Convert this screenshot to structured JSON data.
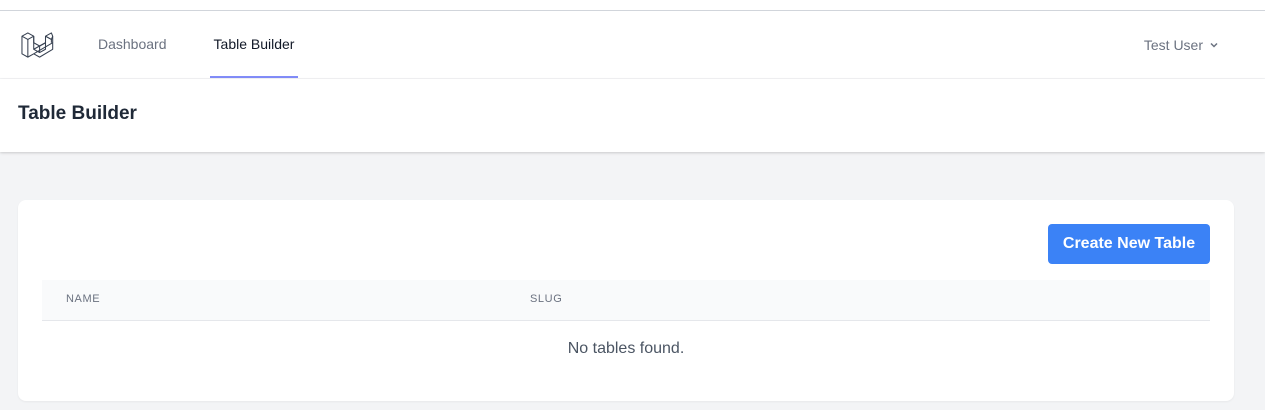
{
  "nav": {
    "links": [
      {
        "label": "Dashboard",
        "active": false
      },
      {
        "label": "Table Builder",
        "active": true
      }
    ],
    "user": {
      "name": "Test User"
    }
  },
  "header": {
    "title": "Table Builder"
  },
  "card": {
    "create_button": "Create New Table",
    "table": {
      "columns": [
        "NAME",
        "SLUG"
      ],
      "rows": [],
      "empty_message": "No tables found."
    }
  },
  "colors": {
    "accent": "#3b82f6",
    "active_tab_underline": "#818cf8",
    "background": "#f3f4f6"
  },
  "icons": {
    "logo": "laravel-logo-icon",
    "user_dropdown": "chevron-down-icon"
  }
}
